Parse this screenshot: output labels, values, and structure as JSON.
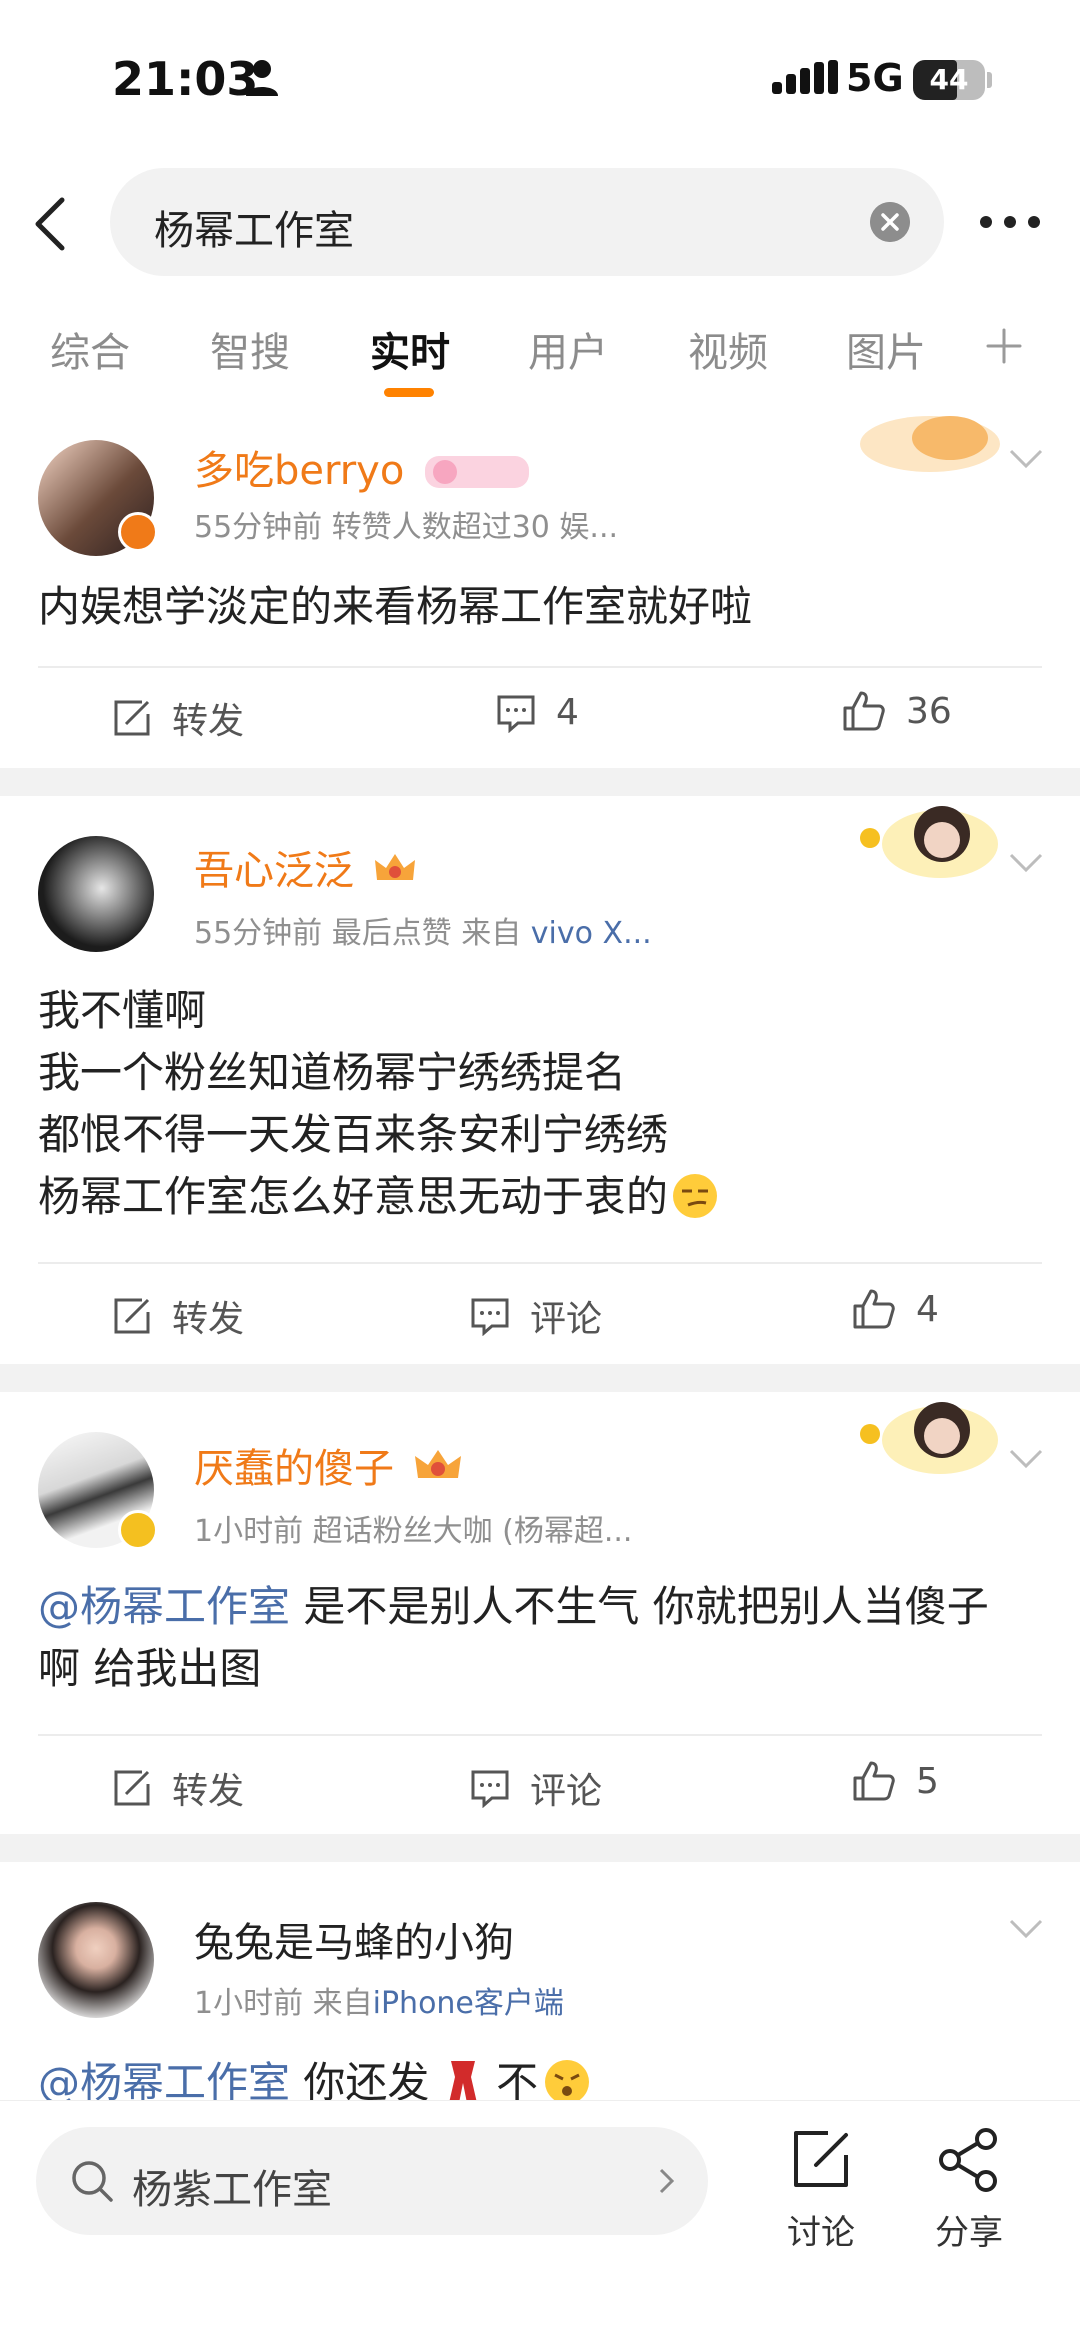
{
  "status": {
    "time": "21:03",
    "network": "5G",
    "battery": "44"
  },
  "header": {
    "query": "杨幂工作室"
  },
  "tabs": [
    {
      "label": "综合",
      "active": false
    },
    {
      "label": "智搜",
      "active": false
    },
    {
      "label": "实时",
      "active": true
    },
    {
      "label": "用户",
      "active": false
    },
    {
      "label": "视频",
      "active": false
    },
    {
      "label": "图片",
      "active": false
    }
  ],
  "posts": [
    {
      "user": "多吃berryo",
      "meta": "55分钟前  转赞人数超过30  娱...",
      "text": "内娱想学淡定的来看杨幂工作室就好啦",
      "repost": "转发",
      "comments": "4",
      "likes": "36"
    },
    {
      "user": "吾心泛泛",
      "meta_prefix": "55分钟前  最后点赞  来自 ",
      "meta_source": "vivo X...",
      "lines": [
        "我不懂啊",
        "我一个粉丝知道杨幂宁绣绣提名",
        "都恨不得一天发百来条安利宁绣绣",
        "杨幂工作室怎么好意思无动于衷的"
      ],
      "repost": "转发",
      "comments": "评论",
      "likes": "4"
    },
    {
      "user": "厌蠢的傻子",
      "meta": "1小时前  超话粉丝大咖 (杨幂超...",
      "mention": "@杨幂工作室",
      "text_line1": " 是不是别人不生气 你就把别人当傻子",
      "text_line2": "啊 给我出图",
      "repost": "转发",
      "comments": "评论",
      "likes": "5"
    },
    {
      "user": "兔兔是马蜂的小狗",
      "meta_prefix": "1小时前  来自",
      "meta_source": "iPhone客户端",
      "mention": "@杨幂工作室",
      "text_a": " 你还发 ",
      "text_b": " 不"
    }
  ],
  "bottom": {
    "query": "杨紫工作室",
    "discuss": "讨论",
    "share": "分享"
  },
  "colors": {
    "accent": "#ff8200",
    "username": "#f07a18",
    "link": "#4a6ea9"
  }
}
